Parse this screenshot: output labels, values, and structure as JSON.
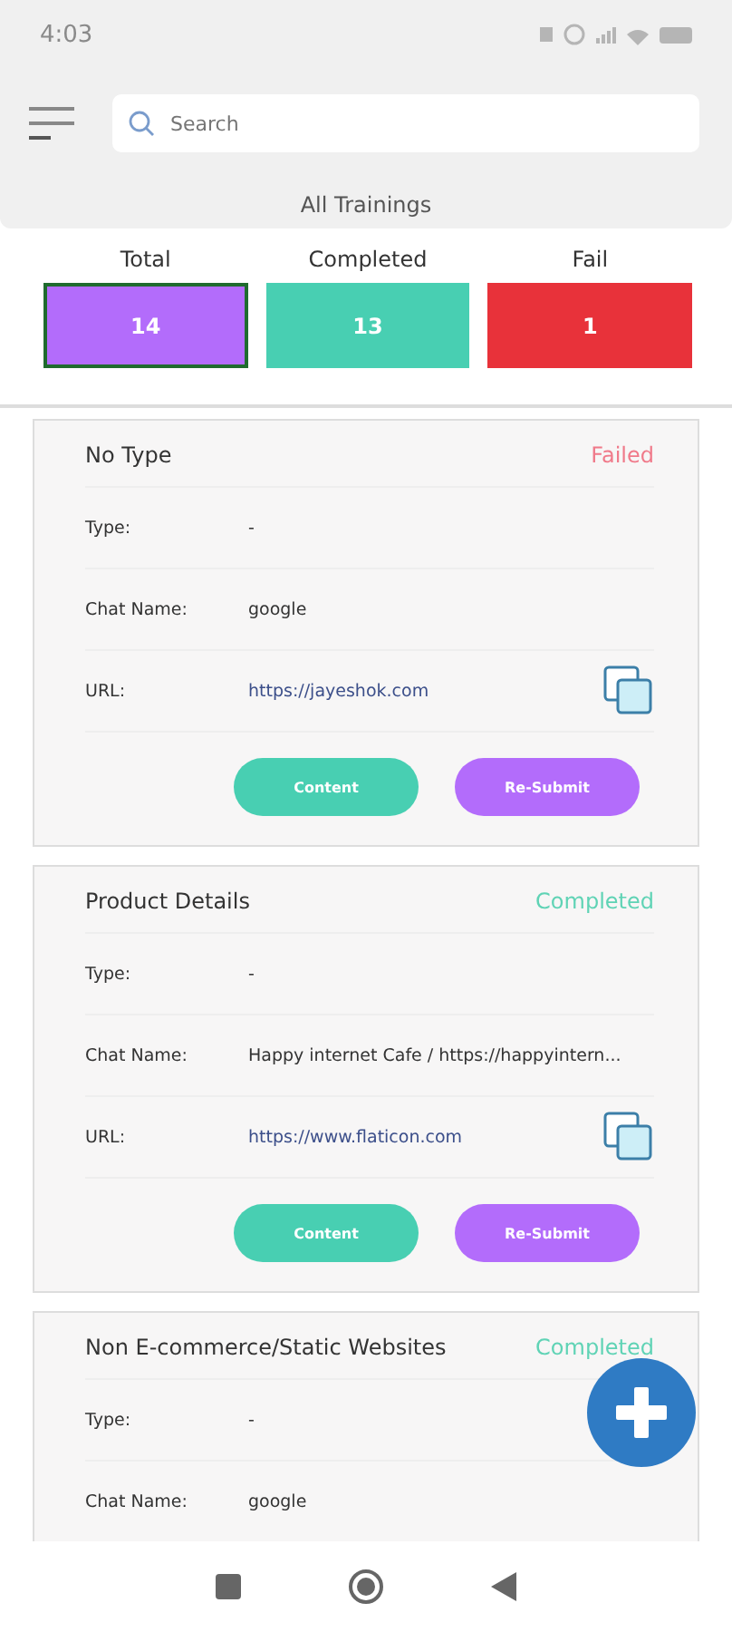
{
  "status_bar": {
    "time": "4:03"
  },
  "search": {
    "placeholder": "Search"
  },
  "section_title": "All Trainings",
  "stats": [
    {
      "label": "Total",
      "value": "14",
      "color": "#b36cfb",
      "selected": true
    },
    {
      "label": "Completed",
      "value": "13",
      "color": "#48cfb2",
      "selected": false
    },
    {
      "label": "Fail",
      "value": "1",
      "color": "#e8323a",
      "selected": false
    }
  ],
  "cards": [
    {
      "title": "No Type",
      "status": "Failed",
      "kind": "failed",
      "fields": [
        {
          "label": "Type:",
          "value": "-"
        },
        {
          "label": "Chat Name:",
          "value": "google"
        },
        {
          "label": "URL:",
          "value": "https://jayeshok.com",
          "kind": "url"
        }
      ],
      "buttons": [
        "Content",
        "Re-Submit"
      ]
    },
    {
      "title": "Product Details",
      "status": "Completed",
      "kind": "completed",
      "fields": [
        {
          "label": "Type:",
          "value": "-"
        },
        {
          "label": "Chat Name:",
          "value": "Happy internet Cafe / https://happyintern..."
        },
        {
          "label": "URL:",
          "value": "https://www.flaticon.com",
          "kind": "url"
        }
      ],
      "buttons": [
        "Content",
        "Re-Submit"
      ]
    },
    {
      "title": "Non E-commerce/Static Websites",
      "status": "Completed",
      "kind": "completed",
      "fields": [
        {
          "label": "Type:",
          "value": "-"
        },
        {
          "label": "Chat Name:",
          "value": "google"
        }
      ]
    }
  ]
}
